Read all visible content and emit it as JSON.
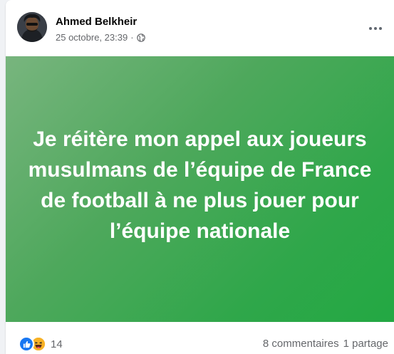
{
  "post": {
    "author": "Ahmed Belkheir",
    "date": "25 octobre, 23:39",
    "separator": "·",
    "visibility_icon": "globe-icon",
    "more_icon": "more-options-icon",
    "text": "Je réitère mon appel aux joueurs musulmans de l’équipe de France de football à ne plus jouer pour l’équipe nationale",
    "background_colors": [
      "#78b57e",
      "#23a843"
    ]
  },
  "footer": {
    "reaction_icons": [
      "like-icon",
      "haha-icon"
    ],
    "reaction_count": "14",
    "comments": "8 commentaires",
    "shares": "1 partage"
  },
  "colors": {
    "like": "#1877f2",
    "haha": "#f7b125",
    "secondary_text": "#65676b"
  }
}
